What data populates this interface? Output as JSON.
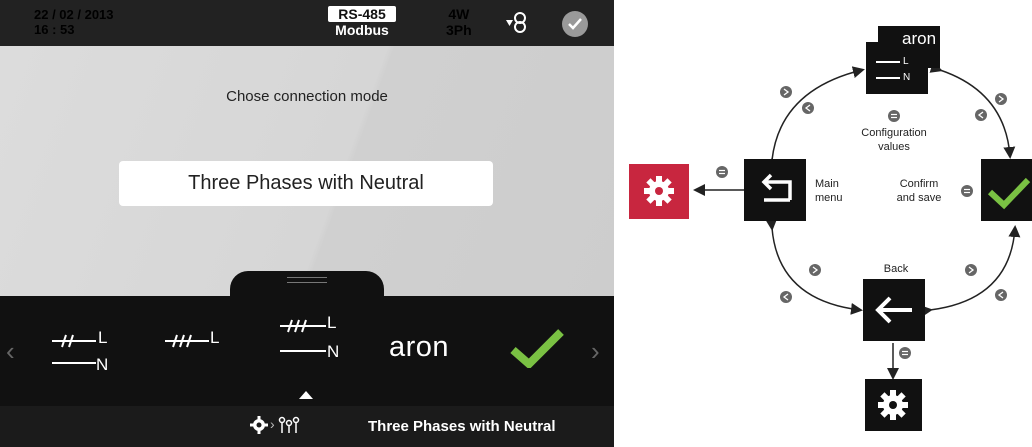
{
  "device": {
    "status_bar": {
      "date": "22 / 02 / 2013",
      "time": "16 : 53",
      "protocol_top": "RS-485",
      "protocol_bottom": "Modbus",
      "wiring_top": "4W",
      "wiring_bottom": "3Ph"
    },
    "prompt": "Chose connection mode",
    "selected_value": "Three Phases with Neutral",
    "options": [
      {
        "line1": "L",
        "line2": "N"
      },
      {
        "line1": "L"
      },
      {
        "line1": "L",
        "line2": "N"
      },
      {
        "brand": "aron"
      }
    ],
    "breadcrumb_label": "Three Phases with Neutral"
  },
  "diagram": {
    "labels": {
      "configuration_values": "Configuration values",
      "main_menu": "Main menu",
      "confirm_and_save": "Confirm and save",
      "back": "Back"
    },
    "top_card": {
      "brand": "aron",
      "line1": "L",
      "line2": "N"
    },
    "colors": {
      "settings_red": "#c8263f",
      "confirm_green": "#7ac143",
      "dark": "#111111",
      "nav_grey": "#666666"
    }
  }
}
